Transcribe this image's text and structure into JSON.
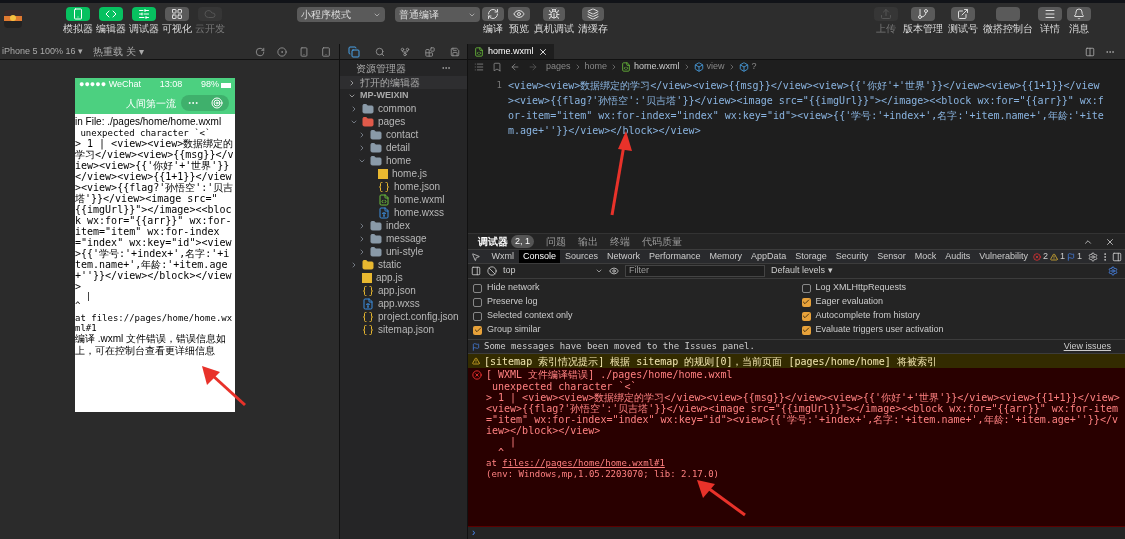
{
  "toolbar": {
    "modes": [
      {
        "label": "模拟器",
        "selected": true,
        "disabled": false
      },
      {
        "label": "编辑器",
        "selected": true,
        "disabled": false
      },
      {
        "label": "调试器",
        "selected": true,
        "disabled": false
      },
      {
        "label": "可视化",
        "selected": false,
        "disabled": false
      },
      {
        "label": "云开发",
        "selected": false,
        "disabled": true
      }
    ],
    "mode_select": {
      "value": "小程序模式"
    },
    "compile_select": {
      "value": "普通编译"
    },
    "actions": [
      {
        "label": "编译"
      },
      {
        "label": "预览"
      },
      {
        "label": "真机调试"
      },
      {
        "label": "清缓存"
      }
    ],
    "right_actions": [
      {
        "label": "上传",
        "disabled": true
      },
      {
        "label": "版本管理",
        "disabled": false
      },
      {
        "label": "测试号",
        "disabled": false
      },
      {
        "label": "微搭控制台",
        "disabled": false
      },
      {
        "label": "详情",
        "disabled": false
      },
      {
        "label": "消息",
        "disabled": false
      }
    ]
  },
  "simulator": {
    "device": "iPhone 5 100% 16 ▾",
    "hot_reload": "热重载 关 ▾",
    "status_bar": {
      "carrier": "●●●●● WeChat",
      "time": "13:08",
      "battery": "98%"
    },
    "nav_title": "人间第一流",
    "error": {
      "title": "in File: ./pages/home/home.wxml",
      "message": " unexpected character `<`",
      "code": "> 1 | <view><view>数据绑定的学习</view><view>{{msg}}</view><view>{{'你好'+'世界'}}</view><view>{{1+1}}</view><view>{{flag?'孙悟空':'贝吉塔'}}</view><image src=\"{{imgUrl}}\"></image><<block wx:for=\"{{arr}}\" wx:for-item=\"item\" wx:for-index=\"index\" wx:key=\"id\"><view>{{'学号:'+index+',名字:'+item.name+',年龄:'+item.age+''}}</view></block></view>",
      "pointer": "  |\n^",
      "location": "at files://pages/home/home.wxml#1",
      "hint": "编译 .wxml 文件错误，错误信息如上，可在控制台查看更详细信息"
    }
  },
  "explorer": {
    "title": "资源管理器",
    "open_editors": "打开的编辑器",
    "project": "MP-WEIXIN",
    "tree": [
      {
        "name": "common",
        "kind": "folder",
        "color": "#8a9aa8",
        "expanded": false
      },
      {
        "name": "pages",
        "kind": "folder",
        "color": "#e05a4a",
        "expanded": true,
        "children": [
          {
            "name": "contact",
            "kind": "folder",
            "color": "#8a9aa8",
            "expanded": false
          },
          {
            "name": "detail",
            "kind": "folder",
            "color": "#8a9aa8",
            "expanded": false
          },
          {
            "name": "home",
            "kind": "folder",
            "color": "#8a9aa8",
            "expanded": true,
            "children": [
              {
                "name": "home.js",
                "kind": "js"
              },
              {
                "name": "home.json",
                "kind": "json"
              },
              {
                "name": "home.wxml",
                "kind": "wxml"
              },
              {
                "name": "home.wxss",
                "kind": "wxss"
              }
            ]
          },
          {
            "name": "index",
            "kind": "folder",
            "color": "#8a9aa8",
            "expanded": false
          },
          {
            "name": "message",
            "kind": "folder",
            "color": "#8a9aa8",
            "expanded": false
          },
          {
            "name": "uni-style",
            "kind": "folder",
            "color": "#8a9aa8",
            "expanded": false
          }
        ]
      },
      {
        "name": "static",
        "kind": "folder",
        "color": "#e8b830",
        "expanded": false
      },
      {
        "name": "app.js",
        "kind": "js"
      },
      {
        "name": "app.json",
        "kind": "json"
      },
      {
        "name": "app.wxss",
        "kind": "wxss"
      },
      {
        "name": "project.config.json",
        "kind": "json"
      },
      {
        "name": "sitemap.json",
        "kind": "json"
      }
    ]
  },
  "editor": {
    "tabs": [
      {
        "label": "home.wxml",
        "selected": true
      }
    ],
    "breadcrumb": [
      "pages",
      "home",
      "home.wxml",
      "view",
      "?"
    ],
    "line_number": "1",
    "code": "<view><view>数据绑定的学习</view><view>{{msg}}</view><view>{{'你好'+'世界'}}</view><view>{{1+1}}</view><view>{{flag?'孙悟空':'贝吉塔'}}</view><image src=\"{{imgUrl}}\"></image><<block wx:for=\"{{arr}}\" wx:for-item=\"item\" wx:for-index=\"index\" wx:key=\"id\"><view>{{'学号:'+index+',名字:'+item.name+',年龄:'+item.age+''}}</view></block></view>"
  },
  "panel": {
    "tabs": [
      {
        "label": "调试器",
        "selected": true,
        "badge": "2, 1"
      },
      {
        "label": "问题",
        "selected": false
      },
      {
        "label": "输出",
        "selected": false
      },
      {
        "label": "终端",
        "selected": false
      },
      {
        "label": "代码质量",
        "selected": false
      }
    ],
    "devtools_tabs": [
      {
        "label": "Wxml",
        "selected": false
      },
      {
        "label": "Console",
        "selected": true
      },
      {
        "label": "Sources",
        "selected": false
      },
      {
        "label": "Network",
        "selected": false
      },
      {
        "label": "Performance",
        "selected": false
      },
      {
        "label": "Memory",
        "selected": false
      },
      {
        "label": "AppData",
        "selected": false
      },
      {
        "label": "Storage",
        "selected": false
      },
      {
        "label": "Security",
        "selected": false
      },
      {
        "label": "Sensor",
        "selected": false
      },
      {
        "label": "Mock",
        "selected": false
      },
      {
        "label": "Audits",
        "selected": false
      },
      {
        "label": "Vulnerability",
        "selected": false
      }
    ],
    "counts": {
      "errors": "2",
      "warnings": "1",
      "info": "1"
    },
    "context": "top",
    "filter": {
      "placeholder": "Filter"
    },
    "levels": "Default levels ▾",
    "settings": [
      {
        "label": "Hide network",
        "checked": false
      },
      {
        "label": "Log XMLHttpRequests",
        "checked": false
      },
      {
        "label": "Preserve log",
        "checked": false
      },
      {
        "label": "Eager evaluation",
        "checked": true
      },
      {
        "label": "Selected context only",
        "checked": false
      },
      {
        "label": "Autocomplete from history",
        "checked": true
      },
      {
        "label": "Group similar",
        "checked": true
      },
      {
        "label": "Evaluate triggers user activation",
        "checked": true
      }
    ],
    "messages": [
      {
        "kind": "info",
        "text": "Some messages have been moved to the Issues panel.",
        "link": "View issues"
      },
      {
        "kind": "warning",
        "text": "[sitemap 索引情况提示] 根据 sitemap 的规则[0]，当前页面 [pages/home/home] 将被索引"
      },
      {
        "kind": "error",
        "text": "[ WXML 文件编译错误] ./pages/home/home.wxml",
        "details": [
          " unexpected character `<`",
          "> 1 | <view><view>数据绑定的学习</view><view>{{msg}}</view><view>{{'你好'+'世界'}}</view><view>{{1+1}}</view><view>{{flag?'孙悟空':'贝吉塔'}}</view><image src=\"{{imgUrl}}\"></image><<block wx:for=\"{{arr}}\" wx:for-item=\"item\" wx:for-index=\"index\" wx:key=\"id\"><view>{{'学号:'+index+',名字:'+item.name+',年龄:'+item.age+''}}</view></block></view>",
          "    |\n  ^"
        ],
        "link": "files://pages/home/home.wxml#1",
        "link_prefix": "at ",
        "env": "(env: Windows,mp,1.05.2203070; lib: 2.17.0)"
      }
    ],
    "prompt": "›"
  }
}
